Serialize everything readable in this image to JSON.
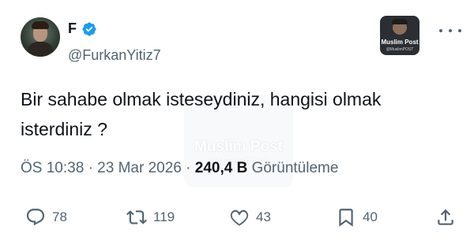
{
  "watermark": {
    "title": "Muslim Post",
    "subtitle": "@MuslimPOST"
  },
  "author": {
    "display_name": "F",
    "handle": "@FurkanYitiz7",
    "verified": true
  },
  "brand": {
    "title": "Muslim Post",
    "subtitle": "@MuslimPOST"
  },
  "tweet": {
    "text": "Bir sahabe olmak isteseydiniz, hangisi olmak isterdiniz ?",
    "time": "ÖS 10:38",
    "date": "23 Mar 2026",
    "separator": "·",
    "views": "240,4 B",
    "views_label": "Görüntüleme"
  },
  "actions": {
    "reply_count": "78",
    "retweet_count": "119",
    "like_count": "43",
    "bookmark_count": "40"
  },
  "colors": {
    "verified": "#1d9bf0",
    "muted": "#536471",
    "text": "#0f1419"
  }
}
